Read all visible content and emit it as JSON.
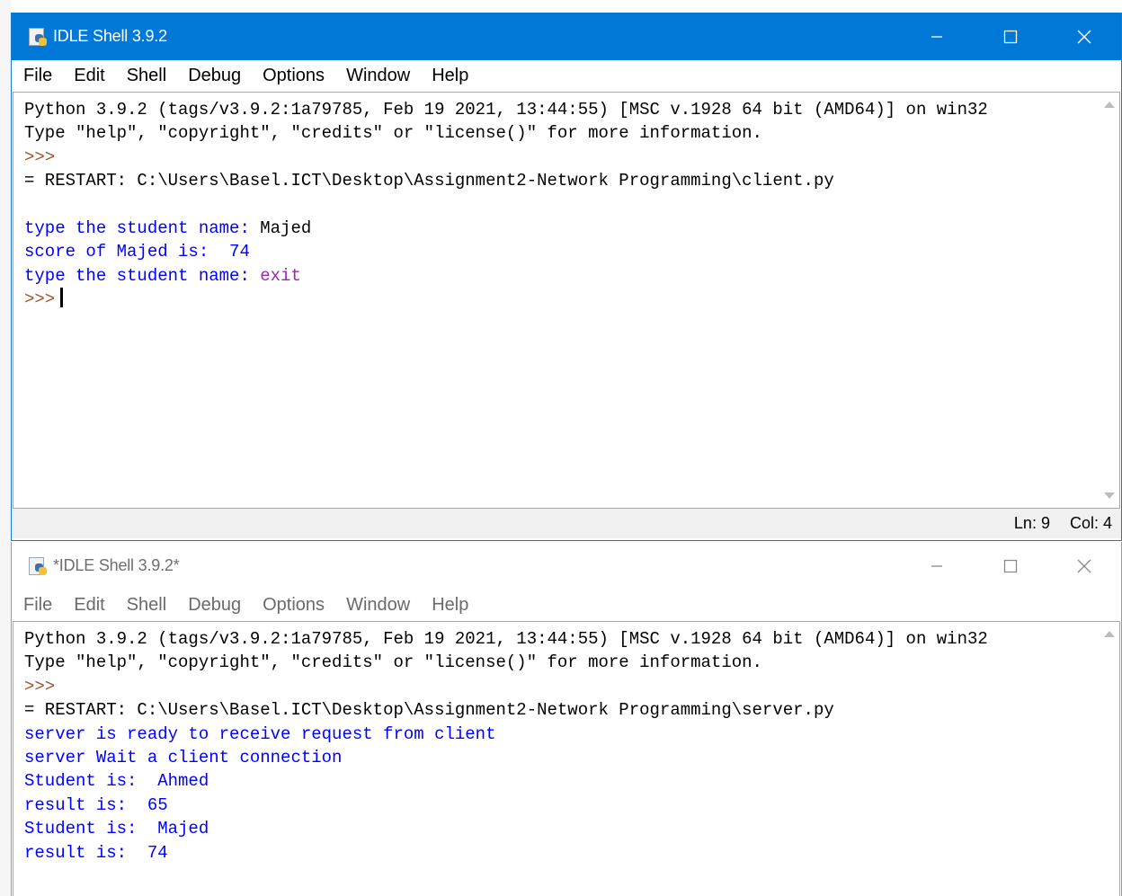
{
  "client_window": {
    "title": "IDLE Shell 3.9.2",
    "active": true,
    "menu": [
      "File",
      "Edit",
      "Shell",
      "Debug",
      "Options",
      "Window",
      "Help"
    ],
    "lines": [
      {
        "text": "Python 3.9.2 (tags/v3.9.2:1a79785, Feb 19 2021, 13:44:55) [MSC v.1928 64 bit (AMD64)] on win32",
        "color": "black"
      },
      {
        "text": "Type \"help\", \"copyright\", \"credits\" or \"license()\" for more information.",
        "color": "black"
      },
      {
        "text": ">>>",
        "color": "prompt"
      },
      {
        "text": "= RESTART: C:\\Users\\Basel.ICT\\Desktop\\Assignment2-Network Programming\\client.py",
        "color": "black"
      },
      {
        "text": "",
        "color": "black"
      },
      {
        "segments": [
          {
            "text": "type the student name: ",
            "color": "blue"
          },
          {
            "text": "Majed",
            "color": "black"
          }
        ]
      },
      {
        "text": "score of Majed is:  74",
        "color": "blue"
      },
      {
        "segments": [
          {
            "text": "type the student name: ",
            "color": "blue"
          },
          {
            "text": "exit",
            "color": "purple"
          }
        ]
      },
      {
        "text": ">>>",
        "color": "prompt",
        "cursor": true
      }
    ],
    "status": {
      "ln": "Ln: 9",
      "col": "Col: 4"
    }
  },
  "server_window": {
    "title": "*IDLE Shell 3.9.2*",
    "active": false,
    "menu": [
      "File",
      "Edit",
      "Shell",
      "Debug",
      "Options",
      "Window",
      "Help"
    ],
    "lines": [
      {
        "text": "Python 3.9.2 (tags/v3.9.2:1a79785, Feb 19 2021, 13:44:55) [MSC v.1928 64 bit (AMD64)] on win32",
        "color": "black"
      },
      {
        "text": "Type \"help\", \"copyright\", \"credits\" or \"license()\" for more information.",
        "color": "black"
      },
      {
        "text": ">>>",
        "color": "prompt"
      },
      {
        "text": "= RESTART: C:\\Users\\Basel.ICT\\Desktop\\Assignment2-Network Programming\\server.py",
        "color": "black"
      },
      {
        "text": "server is ready to receive request from client",
        "color": "blue"
      },
      {
        "text": "server Wait a client connection",
        "color": "blue"
      },
      {
        "text": "Student is:  Ahmed",
        "color": "blue"
      },
      {
        "text": "result is:  65",
        "color": "blue"
      },
      {
        "text": "Student is:  Majed",
        "color": "blue"
      },
      {
        "text": "result is:  74",
        "color": "blue"
      }
    ]
  },
  "colors": {
    "active_titlebar": "#0078d7",
    "output_blue": "#0000ff",
    "prompt": "#a0522d",
    "input_purple": "#9b27b0"
  },
  "icons": [
    "idle-app-icon",
    "minimize-icon",
    "maximize-icon",
    "close-icon",
    "scroll-up-icon",
    "scroll-down-icon"
  ]
}
